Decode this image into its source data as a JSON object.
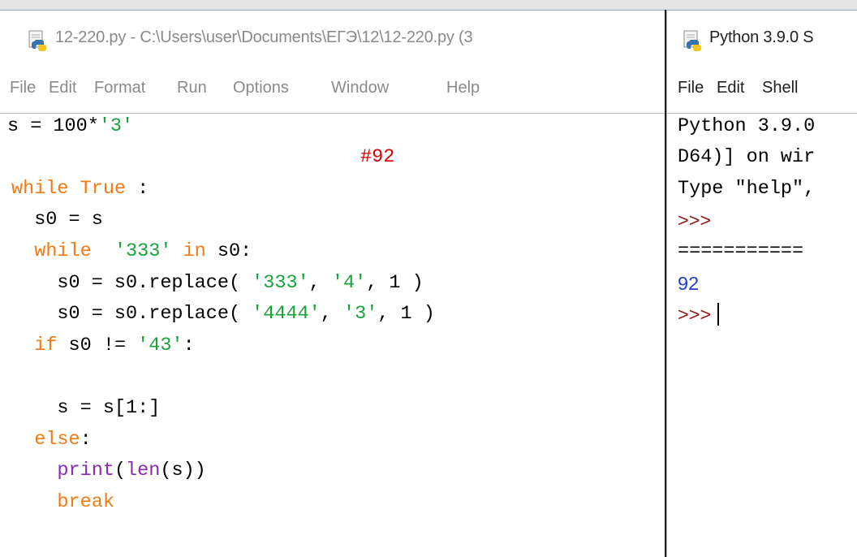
{
  "editor": {
    "title": "12-220.py - C:\\Users\\user\\Documents\\ЕГЭ\\12\\12-220.py (3",
    "menu": [
      "File",
      "Edit",
      "Format",
      "Run",
      "Options",
      "Window",
      "Help"
    ],
    "code": {
      "l1_a": "s = 100*",
      "l1_b": "'3'",
      "l2": "#92",
      "l3_a": "while",
      "l3_b": " ",
      "l3_c": "True",
      "l3_d": " :",
      "l4": "  s0 = s",
      "l5_a": "  ",
      "l5_b": "while",
      "l5_c": "  ",
      "l5_d": "'333'",
      "l5_e": " ",
      "l5_f": "in",
      "l5_g": " s0:",
      "l6_a": "    s0 = s0.replace( ",
      "l6_b": "'333'",
      "l6_c": ", ",
      "l6_d": "'4'",
      "l6_e": ", 1 )",
      "l7_a": "    s0 = s0.replace( ",
      "l7_b": "'4444'",
      "l7_c": ", ",
      "l7_d": "'3'",
      "l7_e": ", 1 )",
      "l8_a": "  ",
      "l8_b": "if",
      "l8_c": " s0 != ",
      "l8_d": "'43'",
      "l8_e": ":",
      "l10": "    s = s[1:]",
      "l11_a": "  ",
      "l11_b": "else",
      "l11_c": ":",
      "l12_a": "    ",
      "l12_b": "print",
      "l12_c": "(",
      "l12_d": "len",
      "l12_e": "(s))",
      "l13_a": "    ",
      "l13_b": "break"
    }
  },
  "shell": {
    "title": "Python 3.9.0 S",
    "menu": [
      "File",
      "Edit",
      "Shell"
    ],
    "lines": {
      "l1": "Python 3.9.0",
      "l2": "D64)] on wir",
      "l3": "Type \"help\",",
      "l4": ">>>",
      "l5": "===========",
      "l6": "92",
      "l7": ">>>"
    }
  },
  "colors": {
    "keyword": "#f07b15",
    "string": "#18a33a",
    "comment": "#d00000",
    "builtin": "#8a2bb5",
    "output": "#1d3fd0",
    "prompt": "#8b1a1a"
  },
  "icons": [
    "idle-python-file-icon",
    "idle-python-shell-icon"
  ]
}
